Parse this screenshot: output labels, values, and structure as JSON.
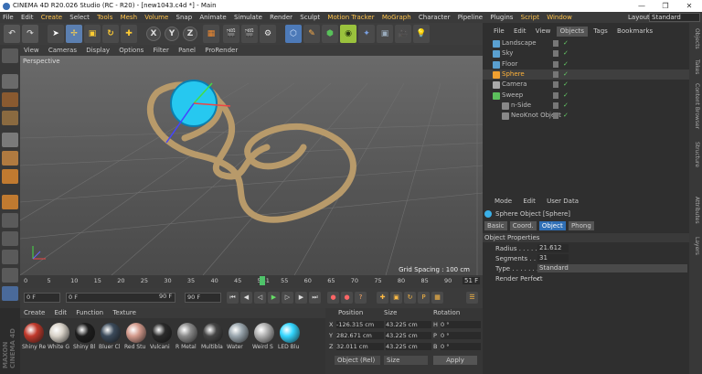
{
  "window": {
    "title": "CINEMA 4D R20.026 Studio (RC - R20) - [new1043.c4d *] - Main",
    "minimize": "—",
    "restore": "❐",
    "close": "✕"
  },
  "menubar": [
    "File",
    "Edit",
    "Create",
    "Select",
    "Tools",
    "Mesh",
    "Volume",
    "Snap",
    "Animate",
    "Simulate",
    "Render",
    "Sculpt",
    "Motion Tracker",
    "MoGraph",
    "Character",
    "Pipeline",
    "Plugins",
    "Script",
    "Window"
  ],
  "menubar_highlight": [
    "Create",
    "Tools",
    "Mesh",
    "Volume",
    "Motion Tracker",
    "MoGraph",
    "Script",
    "Window"
  ],
  "layout": {
    "label": "Layout:",
    "value": "Standard"
  },
  "axis": {
    "x": "X",
    "y": "Y",
    "z": "Z"
  },
  "viewport_menu": [
    "View",
    "Cameras",
    "Display",
    "Options",
    "Filter",
    "Panel",
    "ProRender"
  ],
  "viewport": {
    "label": "Perspective",
    "grid_spacing": "Grid Spacing : 100 cm"
  },
  "timeline": {
    "ticks": [
      "0",
      "5",
      "10",
      "15",
      "20",
      "25",
      "30",
      "35",
      "40",
      "45",
      "50",
      "51",
      "55",
      "60",
      "65",
      "70",
      "75",
      "80",
      "85",
      "90"
    ],
    "current": "51 F",
    "marker_frame": 51
  },
  "transport": {
    "start": "0 F",
    "cur": "0 F",
    "end_a": "90 F",
    "end_b": "90 F"
  },
  "materials_menu": [
    "Create",
    "Edit",
    "Function",
    "Texture"
  ],
  "materials": [
    {
      "name": "Shiny Re",
      "color": "#c0392b"
    },
    {
      "name": "White G",
      "color": "#d8d2c8"
    },
    {
      "name": "Shiny Bl",
      "color": "#1d1d1d"
    },
    {
      "name": "Bluer Cl",
      "color": "#3b4a5a"
    },
    {
      "name": "Red Stu",
      "color": "#d39a8c"
    },
    {
      "name": "Vulcani",
      "color": "#2a2a2a"
    },
    {
      "name": "R Metal",
      "color": "#8a8a8a"
    },
    {
      "name": "Multibla",
      "color": "#444444"
    },
    {
      "name": "Water",
      "color": "#9aa6ae"
    },
    {
      "name": "Weird S",
      "color": "#b0b0b0"
    },
    {
      "name": "LED Blu",
      "color": "#33d6ff"
    }
  ],
  "coords": {
    "headers": [
      "Position",
      "Size",
      "Rotation"
    ],
    "rows": [
      {
        "axis": "X",
        "pos": "-126.315 cm",
        "size": "43.225 cm",
        "rot_label": "H",
        "rot": "0 °"
      },
      {
        "axis": "Y",
        "pos": "282.671 cm",
        "size": "43.225 cm",
        "rot_label": "P",
        "rot": "0 °"
      },
      {
        "axis": "Z",
        "pos": "32.011 cm",
        "size": "43.225 cm",
        "rot_label": "B",
        "rot": "0 °"
      }
    ],
    "mode": "Object (Rel)",
    "size_mode": "Size",
    "apply": "Apply"
  },
  "object_menu": [
    "File",
    "Edit",
    "View",
    "Objects",
    "Tags",
    "Bookmarks"
  ],
  "objects": [
    {
      "name": "Landscape",
      "color": "#5aa0d0",
      "sel": false
    },
    {
      "name": "Sky",
      "color": "#5aa0d0",
      "sel": false
    },
    {
      "name": "Floor",
      "color": "#5aa0d0",
      "sel": false
    },
    {
      "name": "Sphere",
      "color": "#f0a030",
      "sel": true
    },
    {
      "name": "Camera",
      "color": "#aaaaaa",
      "sel": false
    },
    {
      "name": "Sweep",
      "color": "#5cc05c",
      "sel": false
    },
    {
      "name": "n-Side",
      "color": "#888888",
      "sel": false
    },
    {
      "name": "NeoKnot Object",
      "color": "#888888",
      "sel": false
    }
  ],
  "attr_menu": [
    "Mode",
    "Edit",
    "User Data"
  ],
  "attr": {
    "title": "Sphere Object [Sphere]",
    "tabs": [
      "Basic",
      "Coord.",
      "Object",
      "Phong"
    ],
    "active_tab": "Object",
    "section": "Object Properties",
    "props": [
      {
        "label": "Radius . . . . . . .",
        "value": "21.612 cm"
      },
      {
        "label": "Segments . . . . .",
        "value": "31"
      },
      {
        "label": "Type . . . . . . . . .",
        "value": "Standard"
      },
      {
        "label": "Render Perfect",
        "value": "✓"
      }
    ]
  },
  "side_tabs": [
    "Objects",
    "Takes",
    "Content Browser",
    "Structure",
    "Attributes",
    "Layers"
  ]
}
